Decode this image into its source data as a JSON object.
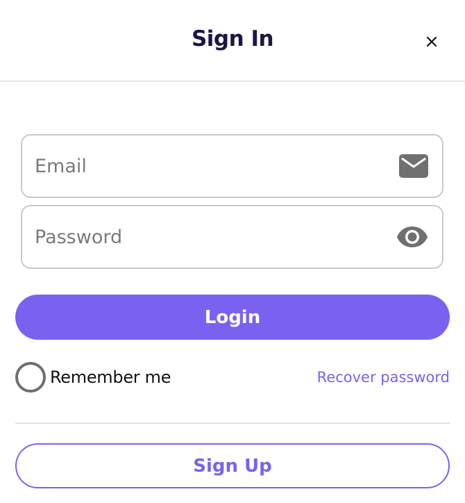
{
  "header": {
    "title": "Sign In",
    "close_icon": "close-icon"
  },
  "form": {
    "email": {
      "value": "",
      "placeholder": "Email",
      "icon": "envelope-icon"
    },
    "password": {
      "value": "",
      "placeholder": "Password",
      "icon": "eye-icon"
    },
    "login_label": "Login",
    "remember_label": "Remember me",
    "remember_checked": false,
    "recover_label": "Recover password",
    "signup_label": "Sign Up"
  },
  "colors": {
    "accent": "#7b61f0",
    "title": "#1d1447",
    "icon": "#707070",
    "border": "#c9c9cc"
  }
}
